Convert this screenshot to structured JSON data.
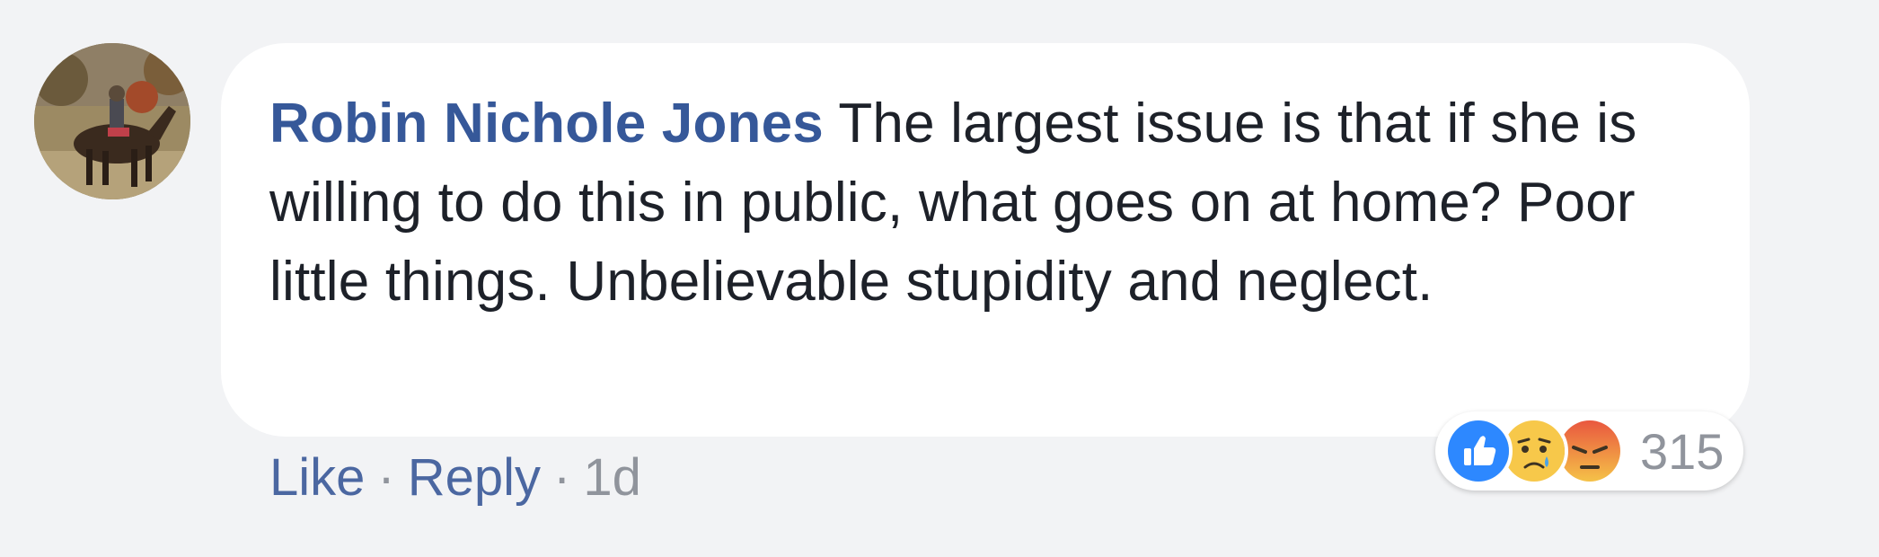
{
  "comment": {
    "author": "Robin Nichole Jones",
    "text": "The largest issue is that if she is willing to do this in public, what goes on at home? Poor little things. Unbelievable stupidity and neglect."
  },
  "actions": {
    "like_label": "Like",
    "reply_label": "Reply",
    "separator": "·",
    "timestamp": "1d"
  },
  "reactions": {
    "icons": [
      "like-icon",
      "sad-icon",
      "angry-icon"
    ],
    "count": "315"
  },
  "colors": {
    "author": "#365899",
    "link": "#4b67a1",
    "meta": "#90949c",
    "background": "#f2f3f5",
    "bubble": "#ffffff",
    "like_blue": "#2d88ff",
    "sad_yellow": "#f7c84a",
    "angry_red": "#e9573f"
  }
}
